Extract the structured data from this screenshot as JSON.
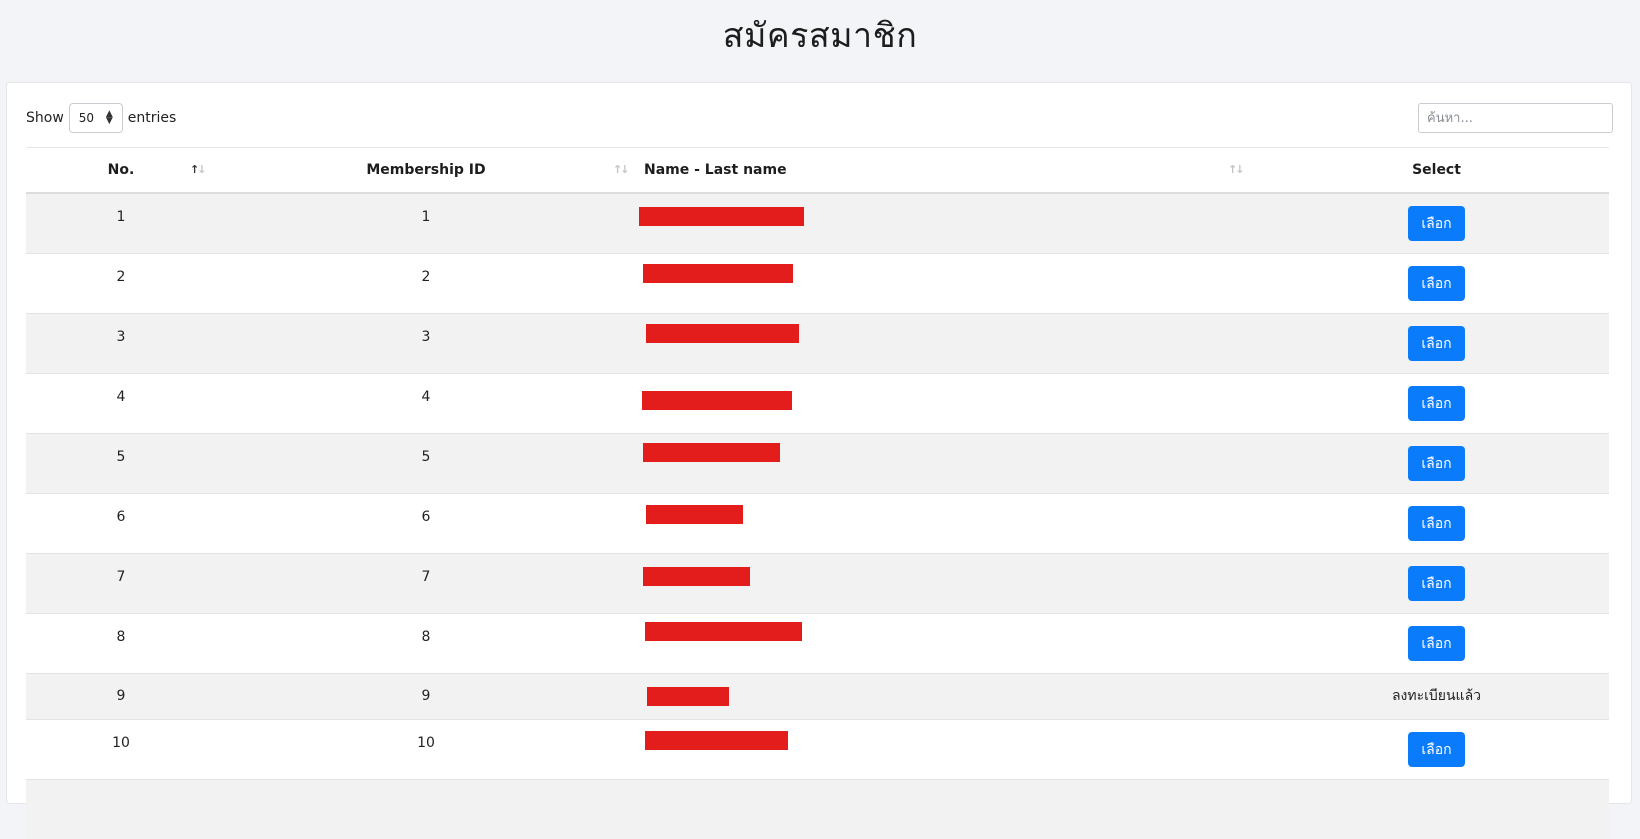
{
  "page": {
    "title": "สมัครสมาชิก"
  },
  "controls": {
    "show_label": "Show",
    "entries_value": "50",
    "entries_label": "entries",
    "search_placeholder": "ค้นหา..."
  },
  "table": {
    "columns": {
      "no": "No.",
      "membership_id": "Membership ID",
      "name": "Name - Last name",
      "select": "Select"
    },
    "rows": [
      {
        "no": "1",
        "id": "1",
        "name_redacted": true,
        "action": "เลือก"
      },
      {
        "no": "2",
        "id": "2",
        "name_redacted": true,
        "action": "เลือก"
      },
      {
        "no": "3",
        "id": "3",
        "name_redacted": true,
        "action": "เลือก"
      },
      {
        "no": "4",
        "id": "4",
        "name_redacted": true,
        "action": "เลือก"
      },
      {
        "no": "5",
        "id": "5",
        "name_redacted": true,
        "action": "เลือก"
      },
      {
        "no": "6",
        "id": "6",
        "name_redacted": true,
        "action": "เลือก"
      },
      {
        "no": "7",
        "id": "7",
        "name_redacted": true,
        "action": "เลือก"
      },
      {
        "no": "8",
        "id": "8",
        "name_redacted": true,
        "action": "เลือก"
      },
      {
        "no": "9",
        "id": "9",
        "name_redacted": true,
        "status": "ลงทะเบียนแล้ว"
      },
      {
        "no": "10",
        "id": "10",
        "name_redacted": true,
        "action": "เลือก"
      }
    ]
  },
  "colors": {
    "button": "#0a7cfb",
    "redaction": "#e31c1c",
    "stripe": "#f2f2f2"
  },
  "icons": {
    "sort": "sort-arrows-icon",
    "length_select": "select-arrows-icon"
  }
}
